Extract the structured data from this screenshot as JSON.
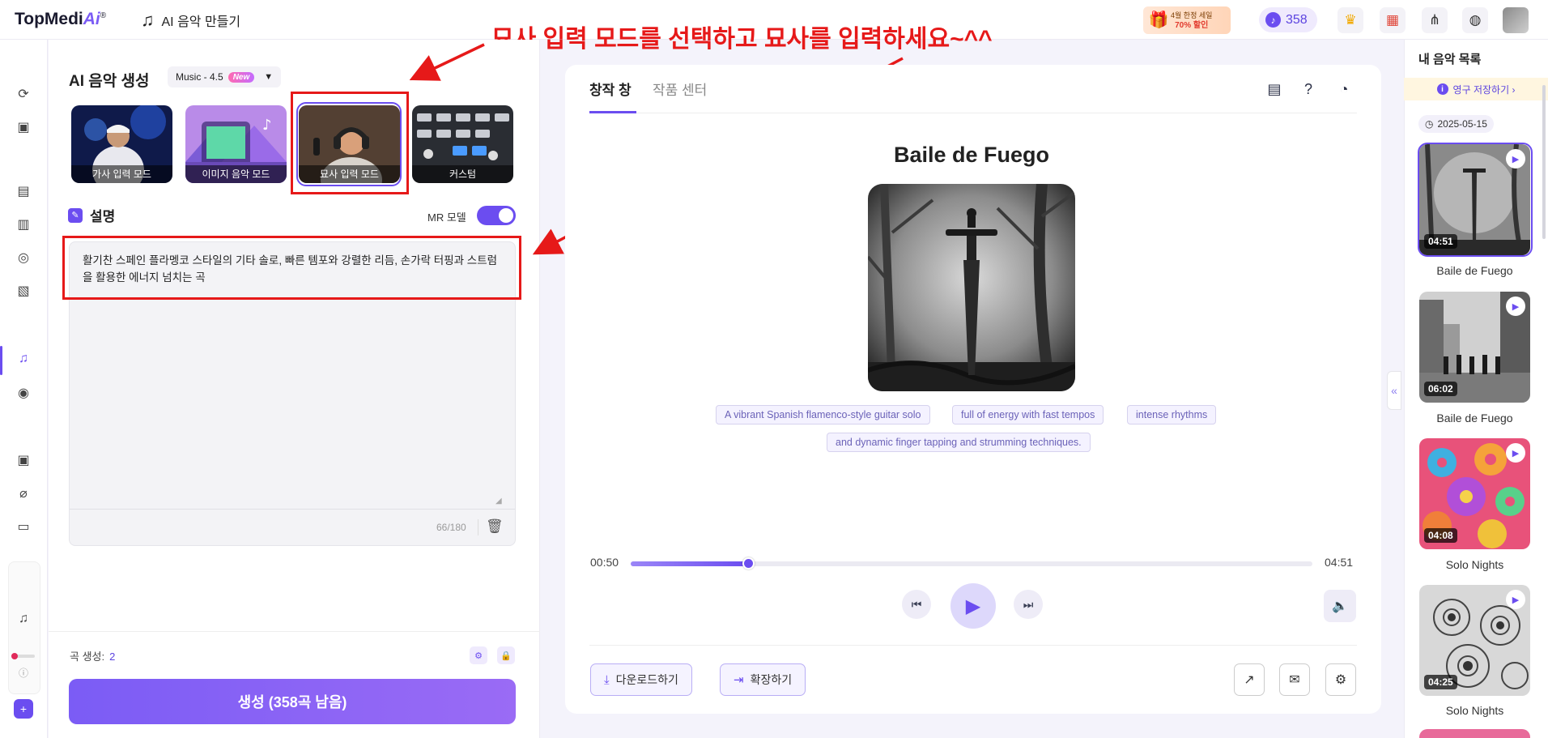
{
  "topbar": {
    "logo_text": "TopMedi",
    "logo_ai": "Ai",
    "logo_mark": "®",
    "music_maker_label": "AI 음악 만들기",
    "promo_line1": "4월 한정 세일",
    "promo_line2": "70% 할인",
    "credits": "358"
  },
  "annotation": {
    "text": "묘사 입력 모드를 선택하고 묘사를 입력하세요~^^",
    "color": "#e61919"
  },
  "left_panel": {
    "title": "AI 음악 생성",
    "version": "Music - 4.5",
    "version_badge": "New",
    "modes": [
      {
        "label": "가사 입력 모드"
      },
      {
        "label": "이미지 음악 모드"
      },
      {
        "label": "묘사 입력 모드"
      },
      {
        "label": "커스텀"
      }
    ],
    "selected_mode": "묘사 입력 모드",
    "description_title": "설명",
    "mr_label": "MR 모델",
    "mr_enabled": true,
    "description_text": "활기찬 스페인 플라멩코 스타일의 기타 솔로, 빠른 템포와 강렬한 리듬, 손가락 터핑과 스트럼을 활용한 에너지 넘치는 곡",
    "char_count": "66/180",
    "songs_label": "곡 생성:",
    "songs_value": "2",
    "generate_button": "생성 (358곡 남음)"
  },
  "center": {
    "tabs": [
      "창작 창",
      "작품 센터"
    ],
    "active_tab": "창작 창",
    "song_title": "Baile de Fuego",
    "tags": [
      "A vibrant Spanish flamenco-style guitar solo",
      "full of energy with fast tempos",
      "intense rhythms",
      "and dynamic finger tapping and strumming techniques."
    ],
    "current_time": "00:50",
    "total_time": "04:51",
    "progress_fraction": 0.172,
    "download_button": "다운로드하기",
    "extend_button": "확장하기"
  },
  "right_panel": {
    "title": "내 음악 목록",
    "banner": "영구 저장하기 ›",
    "date": "2025-05-15",
    "items": [
      {
        "name": "Baile de Fuego",
        "duration": "04:51"
      },
      {
        "name": "Baile de Fuego",
        "duration": "06:02"
      },
      {
        "name": "Solo Nights",
        "duration": "04:08"
      },
      {
        "name": "Solo Nights",
        "duration": "04:25"
      }
    ]
  },
  "colors": {
    "accent": "#6b4df0",
    "annotation_red": "#e61919"
  }
}
